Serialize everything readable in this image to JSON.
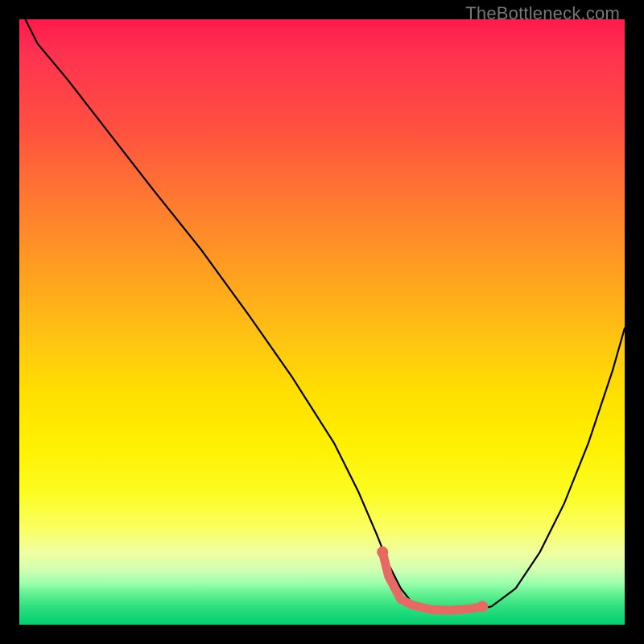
{
  "watermark": "TheBottleneck.com",
  "chart_data": {
    "type": "line",
    "title": "",
    "xlabel": "",
    "ylabel": "",
    "xlim": [
      0,
      100
    ],
    "ylim": [
      0,
      100
    ],
    "series": [
      {
        "name": "curve",
        "x": [
          1,
          3,
          8,
          15,
          22,
          30,
          38,
          45,
          52,
          56,
          59,
          61,
          63,
          65,
          68,
          71,
          73,
          75,
          78,
          82,
          86,
          90,
          94,
          98,
          100
        ],
        "y": [
          100,
          96,
          90,
          81,
          72,
          62,
          51,
          41,
          30,
          22,
          15,
          10,
          6,
          3.5,
          2.3,
          2.1,
          2.2,
          2.4,
          3,
          6,
          12,
          20,
          30,
          42,
          49
        ]
      },
      {
        "name": "highlight",
        "x": [
          60,
          61,
          63,
          65,
          68,
          71,
          73,
          75,
          76.5
        ],
        "y": [
          12,
          8,
          4.2,
          3.2,
          2.5,
          2.4,
          2.5,
          2.7,
          3.0
        ]
      }
    ],
    "markers": [
      {
        "name": "start-dot",
        "x": 60,
        "y": 12
      },
      {
        "name": "end-dot",
        "x": 76.5,
        "y": 3.0
      }
    ]
  }
}
